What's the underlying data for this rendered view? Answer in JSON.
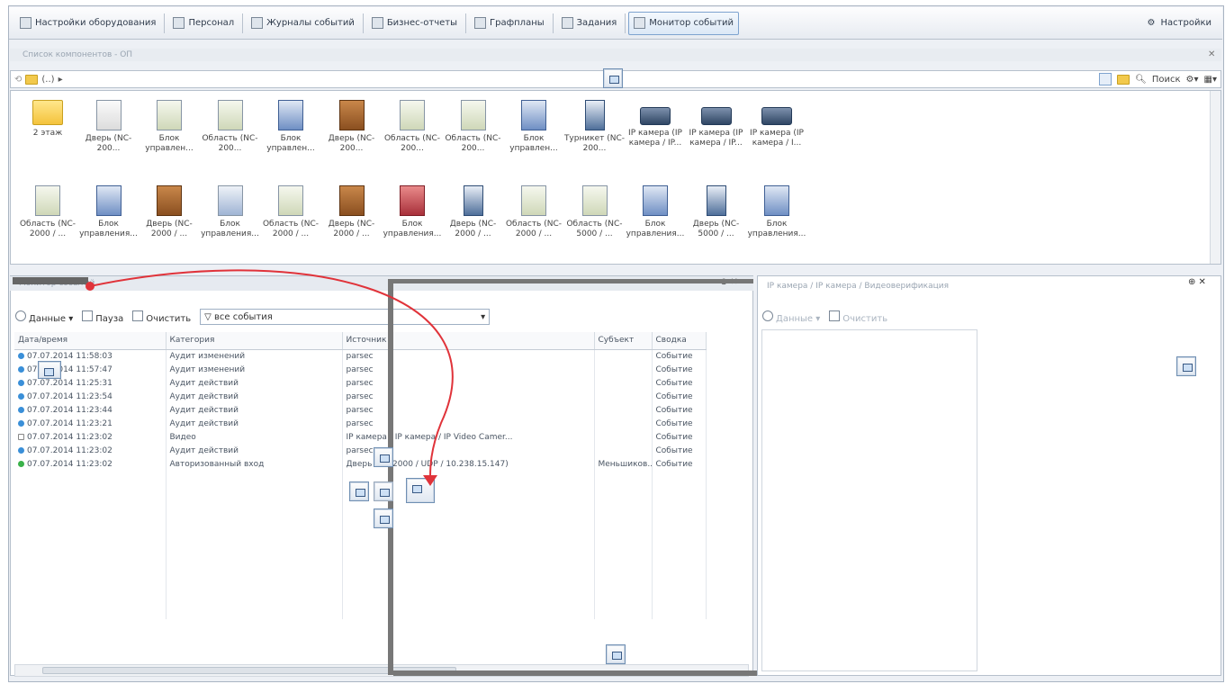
{
  "toolbar": {
    "items": [
      {
        "label": "Настройки оборудования",
        "icon": "equipment-icon"
      },
      {
        "label": "Персонал",
        "icon": "personnel-icon"
      },
      {
        "label": "Журналы событий",
        "icon": "journal-icon"
      },
      {
        "label": "Бизнес-отчеты",
        "icon": "reports-icon"
      },
      {
        "label": "Графпланы",
        "icon": "floorplan-icon"
      },
      {
        "label": "Задания",
        "icon": "tasks-icon"
      },
      {
        "label": "Монитор событий",
        "icon": "monitor-icon"
      }
    ],
    "settings_label": "Настройки"
  },
  "objects_panel": {
    "header": "Список компонентов - ОП",
    "path": "(..)",
    "search_label": "Поиск",
    "items_row1": [
      {
        "label": "2 этаж",
        "kind": "folder"
      },
      {
        "label": "Дверь (NC-200...",
        "kind": "doorw"
      },
      {
        "label": "Блок управлен...",
        "kind": "area"
      },
      {
        "label": "Область (NC-200...",
        "kind": "area"
      },
      {
        "label": "Блок управлен...",
        "kind": "block"
      },
      {
        "label": "Дверь (NC-200...",
        "kind": "door"
      },
      {
        "label": "Область (NC-200...",
        "kind": "area"
      },
      {
        "label": "Область (NC-200...",
        "kind": "area"
      },
      {
        "label": "Блок управлен...",
        "kind": "block"
      },
      {
        "label": "Турникет (NC-200...",
        "kind": "turn"
      },
      {
        "label": "IP камера (IP камера / IP...",
        "kind": "cam"
      },
      {
        "label": "IP камера (IP камера / IP...",
        "kind": "cam"
      },
      {
        "label": "IP камера (IP камера / I...",
        "kind": "cam"
      }
    ],
    "items_row2": [
      {
        "label": "Область (NC-2000 / ...",
        "kind": "area"
      },
      {
        "label": "Блок управления...",
        "kind": "block"
      },
      {
        "label": "Дверь (NC-2000 / ...",
        "kind": "door"
      },
      {
        "label": "Блок управления...",
        "kind": "areab"
      },
      {
        "label": "Область (NC-2000 / ...",
        "kind": "area"
      },
      {
        "label": "Дверь (NC-2000 / ...",
        "kind": "door"
      },
      {
        "label": "Блок управления...",
        "kind": "red"
      },
      {
        "label": "Дверь (NC-2000 / ...",
        "kind": "turn"
      },
      {
        "label": "Область (NC-2000 / ...",
        "kind": "area"
      },
      {
        "label": "Область (NC-5000 / ...",
        "kind": "area"
      },
      {
        "label": "Блок управления...",
        "kind": "block"
      },
      {
        "label": "Дверь (NC-5000 / ...",
        "kind": "turn"
      },
      {
        "label": "Блок управления...",
        "kind": "block"
      }
    ]
  },
  "events_panel": {
    "tab": "Монитор событий",
    "data_label": "Данные",
    "pause_label": "Пауза",
    "clear_label": "Очистить",
    "filter_value": "все события",
    "columns": [
      "Дата/время",
      "Категория",
      "Источник",
      "Субъект",
      "Сводка"
    ],
    "rows": [
      {
        "dt": "07.07.2014 11:58:03",
        "cat": "Аудит изменений",
        "src": "parsec",
        "subj": "",
        "sum": "Событие",
        "dot": "b"
      },
      {
        "dt": "07.07.2014 11:57:47",
        "cat": "Аудит изменений",
        "src": "parsec",
        "subj": "",
        "sum": "Событие",
        "dot": "b"
      },
      {
        "dt": "07.07.2014 11:25:31",
        "cat": "Аудит действий",
        "src": "parsec",
        "subj": "",
        "sum": "Событие",
        "dot": "b"
      },
      {
        "dt": "07.07.2014 11:23:54",
        "cat": "Аудит действий",
        "src": "parsec",
        "subj": "",
        "sum": "Событие",
        "dot": "b"
      },
      {
        "dt": "07.07.2014 11:23:44",
        "cat": "Аудит действий",
        "src": "parsec",
        "subj": "",
        "sum": "Событие",
        "dot": "b"
      },
      {
        "dt": "07.07.2014 11:23:21",
        "cat": "Аудит действий",
        "src": "parsec",
        "subj": "",
        "sum": "Событие",
        "dot": "b"
      },
      {
        "dt": "07.07.2014 11:23:02",
        "cat": "Видео",
        "src": "IP камера / IP камера / IP Video Camer...",
        "subj": "",
        "sum": "Событие",
        "dot": "v"
      },
      {
        "dt": "07.07.2014 11:23:02",
        "cat": "Аудит действий",
        "src": "parsec",
        "subj": "",
        "sum": "Событие",
        "dot": "b"
      },
      {
        "dt": "07.07.2014 11:23:02",
        "cat": "Авторизованный вход",
        "src": "Дверь (NC-2000 / UDP / 10.238.15.147)",
        "subj": "Меньшиков...",
        "sum": "Событие",
        "dot": "g"
      }
    ]
  },
  "video_panel": {
    "tabs": "IP камера / IP камера / Видеоверификация",
    "data_label": "Данные",
    "clear_label": "Очистить"
  }
}
